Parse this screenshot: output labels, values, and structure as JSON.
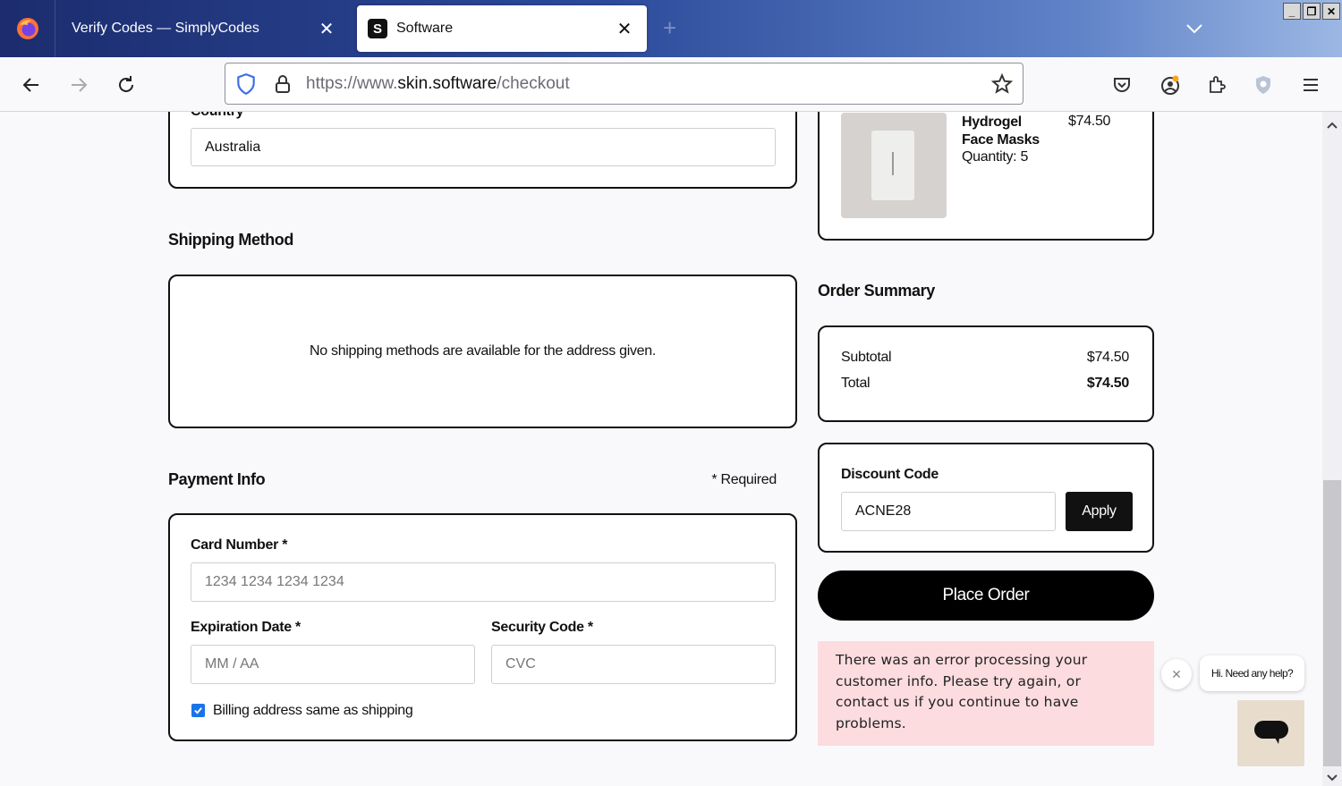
{
  "browser": {
    "tabs": [
      {
        "title": "Verify Codes — SimplyCodes",
        "active": false
      },
      {
        "title": "Software",
        "active": true,
        "favicon_letter": "S"
      }
    ],
    "url": {
      "scheme": "https://www.",
      "host": "skin.software",
      "path": "/checkout"
    }
  },
  "checkout": {
    "country": {
      "label": "Country",
      "value": "Australia"
    },
    "shipping": {
      "title": "Shipping Method",
      "message": "No shipping methods are available for the address given."
    },
    "payment": {
      "title": "Payment Info",
      "required_note": "* Required",
      "card_number": {
        "label": "Card Number *",
        "placeholder": "1234 1234 1234 1234"
      },
      "expiration": {
        "label": "Expiration Date *",
        "placeholder": "MM / AA"
      },
      "security": {
        "label": "Security Code *",
        "placeholder": "CVC"
      },
      "billing_same": {
        "label": "Billing address same as shipping",
        "checked": true
      }
    }
  },
  "cart": {
    "item": {
      "name_line1": "Hydrogel",
      "name_line2": "Face Masks",
      "quantity": "Quantity: 5",
      "price": "$74.50"
    }
  },
  "order_summary": {
    "title": "Order Summary",
    "subtotal_label": "Subtotal",
    "subtotal_value": "$74.50",
    "total_label": "Total",
    "total_value": "$74.50"
  },
  "discount": {
    "title": "Discount Code",
    "value": "ACNE28",
    "apply_label": "Apply"
  },
  "place_order_label": "Place Order",
  "error_message": "There was an error processing your customer info. Please try again, or contact us if you continue to have problems.",
  "chat": {
    "bubble_text": "Hi. Need any help?"
  },
  "colors": {
    "accent": "#111111",
    "error_bg": "#fcdcdf",
    "checkbox": "#1a73e8"
  }
}
